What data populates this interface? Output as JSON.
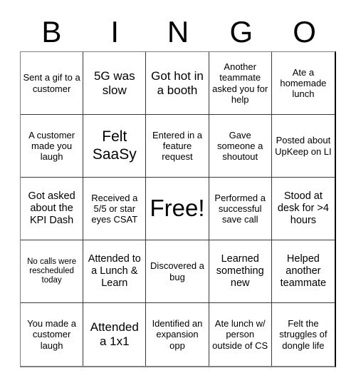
{
  "card": {
    "header_letters": [
      "B",
      "I",
      "N",
      "G",
      "O"
    ],
    "free_space_label": "Free!",
    "cells": [
      {
        "text": "Sent a gif to a customer",
        "size": "s"
      },
      {
        "text": "5G was slow",
        "size": "l"
      },
      {
        "text": "Got hot in a booth",
        "size": "l"
      },
      {
        "text": "Another teammate asked you for help",
        "size": "s"
      },
      {
        "text": "Ate a homemade lunch",
        "size": "s"
      },
      {
        "text": "A customer made you laugh",
        "size": "s"
      },
      {
        "text": "Felt SaaSy",
        "size": "xl"
      },
      {
        "text": "Entered in a feature request",
        "size": "s"
      },
      {
        "text": "Gave someone a shoutout",
        "size": "s"
      },
      {
        "text": "Posted about UpKeep on LI",
        "size": "s"
      },
      {
        "text": "Got asked about the KPI Dash",
        "size": "m"
      },
      {
        "text": "Received a 5/5 or star eyes CSAT",
        "size": "s"
      },
      {
        "text": "Free!",
        "size": "free"
      },
      {
        "text": "Performed a successful save call",
        "size": "s"
      },
      {
        "text": "Stood at desk for >4 hours",
        "size": "m"
      },
      {
        "text": "No calls were rescheduled today",
        "size": "xs"
      },
      {
        "text": "Attended to a Lunch & Learn",
        "size": "m"
      },
      {
        "text": "Discovered a bug",
        "size": "s"
      },
      {
        "text": "Learned something new",
        "size": "m"
      },
      {
        "text": "Helped another teammate",
        "size": "m"
      },
      {
        "text": "You made a customer laugh",
        "size": "s"
      },
      {
        "text": "Attended a 1x1",
        "size": "l"
      },
      {
        "text": "Identified an expansion opp",
        "size": "s"
      },
      {
        "text": "Ate lunch w/ person outside of CS",
        "size": "s"
      },
      {
        "text": "Felt the struggles of dongle life",
        "size": "s"
      }
    ]
  }
}
